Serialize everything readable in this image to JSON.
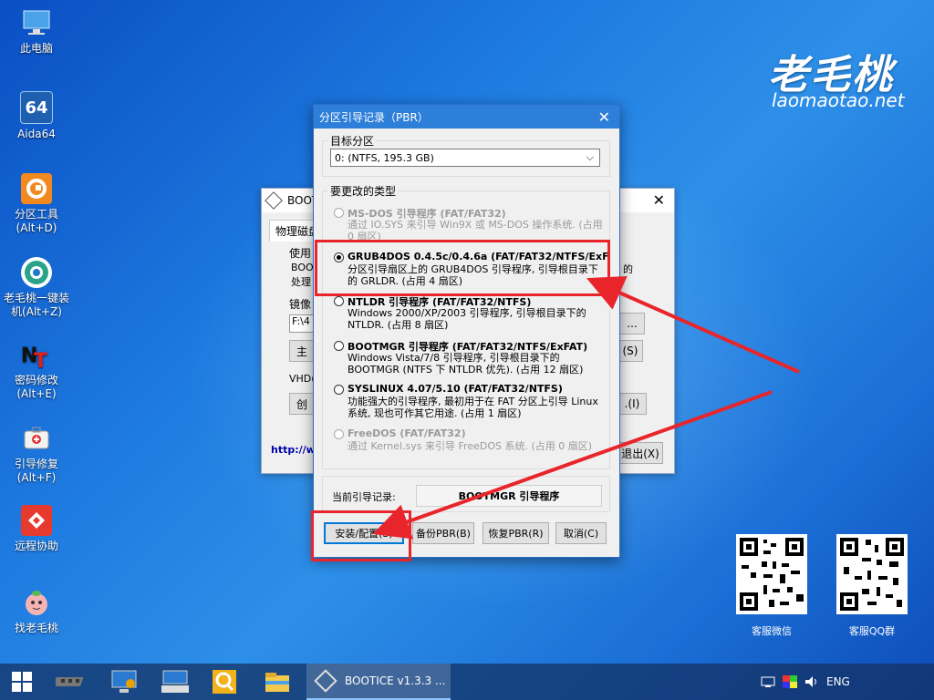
{
  "desktop": {
    "icons": [
      {
        "label1": "此电脑",
        "label2": ""
      },
      {
        "label1": "Aida64",
        "label2": ""
      },
      {
        "label1": "分区工具",
        "label2": "(Alt+D)"
      },
      {
        "label1": "老毛桃一键装",
        "label2": "机(Alt+Z)"
      },
      {
        "label1": "密码修改",
        "label2": "(Alt+E)"
      },
      {
        "label1": "引导修复",
        "label2": "(Alt+F)"
      },
      {
        "label1": "远程协助",
        "label2": ""
      },
      {
        "label1": "找老毛桃",
        "label2": ""
      }
    ],
    "aida_badge": "64",
    "brand_cn": "老毛桃",
    "brand_en": "laomaotao.net",
    "qr1_label": "客服微信",
    "qr2_label": "客服QQ群"
  },
  "bgwindow": {
    "title": "BOOTI",
    "tab": "物理磁盘",
    "use_label": "使用",
    "line1": "BOOT",
    "line2": "处理",
    "right_text": "的",
    "image_label": "镜像",
    "image_value": "F:\\4",
    "browse": "...",
    "main_btn": "主",
    "s_btn": "(S)",
    "vhd_label": "VHD(",
    "create_btn": "创",
    "i_btn": ".(I)",
    "link": "http://w",
    "exit_btn": "退出(X)"
  },
  "dialog": {
    "title": "分区引导记录（PBR）",
    "target_label": "目标分区",
    "target_value": "0: (NTFS, 195.3 GB)",
    "type_label": "要更改的类型",
    "options": [
      {
        "name": "MS-DOS 引导程序 (FAT/FAT32)",
        "desc": "通过 IO.SYS 来引导 Win9X 或 MS-DOS 操作系统. (占用 0 扇区)"
      },
      {
        "name": "GRUB4DOS 0.4.5c/0.4.6a (FAT/FAT32/NTFS/ExF",
        "desc": "分区引导扇区上的 GRUB4DOS 引导程序, 引导根目录下的 GRLDR. (占用 4 扇区)"
      },
      {
        "name": "NTLDR 引导程序 (FAT/FAT32/NTFS)",
        "desc": "Windows 2000/XP/2003 引导程序, 引导根目录下的 NTLDR. (占用 8 扇区)"
      },
      {
        "name": "BOOTMGR 引导程序 (FAT/FAT32/NTFS/ExFAT)",
        "desc": "Windows Vista/7/8 引导程序, 引导根目录下的 BOOTMGR (NTFS 下 NTLDR 优先). (占用 12 扇区)"
      },
      {
        "name": "SYSLINUX 4.07/5.10 (FAT/FAT32/NTFS)",
        "desc": "功能强大的引导程序, 最初用于在 FAT 分区上引导 Linux 系统, 现也可作其它用途. (占用 1 扇区)"
      },
      {
        "name": "FreeDOS (FAT/FAT32)",
        "desc": "通过 Kernel.sys 来引导 FreeDOS 系统. (占用 0 扇区)"
      }
    ],
    "current_label": "当前引导记录:",
    "current_value": "BOOTMGR 引导程序",
    "buttons": {
      "install": "安装/配置(S)",
      "backup": "备份PBR(B)",
      "restore": "恢复PBR(R)",
      "cancel": "取消(C)"
    }
  },
  "taskbar": {
    "active_label": "BOOTICE v1.3.3 ...",
    "lang": "ENG"
  },
  "colors": {
    "accent": "#2e7fd9",
    "highlight": "#e8252b"
  }
}
